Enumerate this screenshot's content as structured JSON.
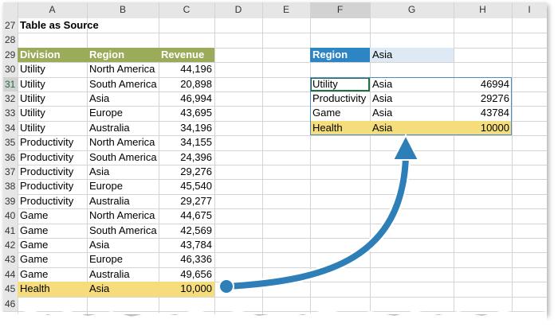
{
  "sheet": {
    "columns": [
      "",
      "A",
      "B",
      "C",
      "D",
      "E",
      "F",
      "G",
      "H",
      "I"
    ],
    "row_numbers": [
      "27",
      "28",
      "29",
      "30",
      "31",
      "32",
      "33",
      "34",
      "35",
      "36",
      "37",
      "38",
      "39",
      "40",
      "41",
      "42",
      "43",
      "44",
      "45",
      "46"
    ],
    "title": "Table as Source",
    "source_table": {
      "headers": [
        "Division",
        "Region",
        "Revenue"
      ],
      "rows": [
        [
          "Utility",
          "North America",
          "44,196"
        ],
        [
          "Utility",
          "South America",
          "20,898"
        ],
        [
          "Utility",
          "Asia",
          "46,994"
        ],
        [
          "Utility",
          "Europe",
          "43,695"
        ],
        [
          "Utility",
          "Australia",
          "34,196"
        ],
        [
          "Productivity",
          "North America",
          "34,155"
        ],
        [
          "Productivity",
          "South America",
          "24,396"
        ],
        [
          "Productivity",
          "Asia",
          "29,276"
        ],
        [
          "Productivity",
          "Europe",
          "45,540"
        ],
        [
          "Productivity",
          "Australia",
          "29,277"
        ],
        [
          "Game",
          "North America",
          "44,675"
        ],
        [
          "Game",
          "South America",
          "42,569"
        ],
        [
          "Game",
          "Asia",
          "43,784"
        ],
        [
          "Game",
          "Europe",
          "46,336"
        ],
        [
          "Game",
          "Australia",
          "49,656"
        ],
        [
          "Health",
          "Asia",
          "10,000"
        ]
      ]
    },
    "filter": {
      "label": "Region",
      "value": "Asia"
    },
    "result_table": {
      "rows": [
        [
          "Utility",
          "Asia",
          "46994"
        ],
        [
          "Productivity",
          "Asia",
          "29276"
        ],
        [
          "Game",
          "Asia",
          "43784"
        ],
        [
          "Health",
          "Asia",
          "10000"
        ]
      ]
    }
  },
  "colors": {
    "header_green": "#9aab5a",
    "highlight_yellow": "#f6dd7b",
    "filter_blue": "#2e85c4",
    "filter_light_blue": "#ddeaf6",
    "arrow_blue": "#2e7fb8"
  }
}
